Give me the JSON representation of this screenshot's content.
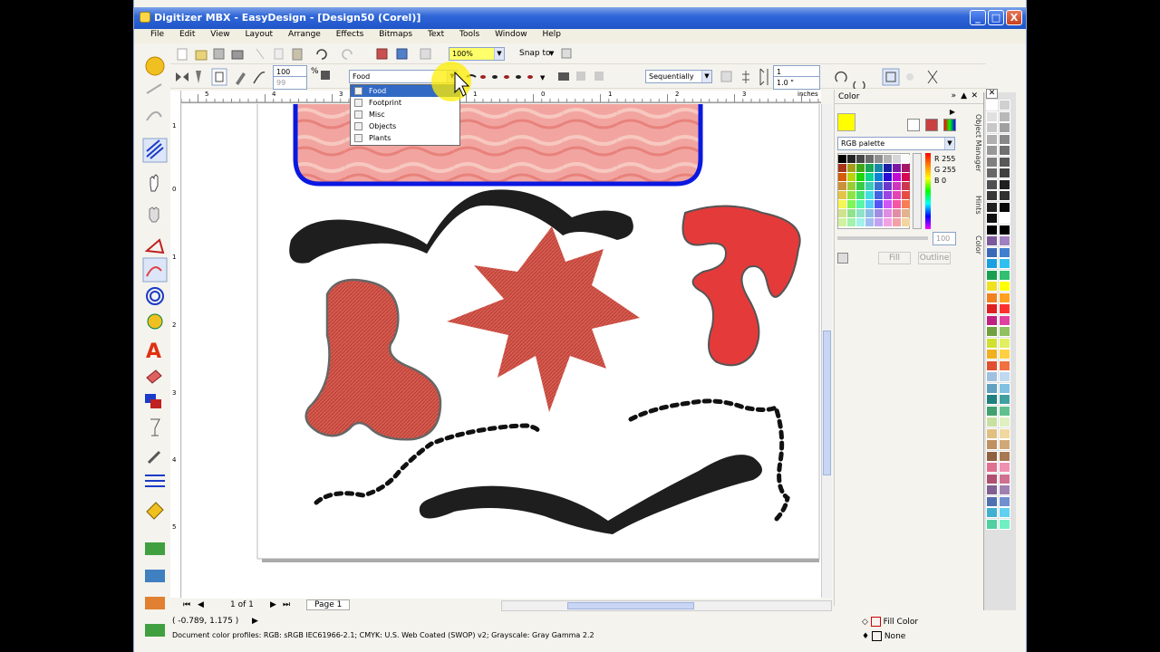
{
  "window": {
    "title": "Digitizer MBX - EasyDesign - [Design50 (Corel)]",
    "controls": [
      "_",
      "□",
      "X"
    ]
  },
  "menu": [
    "File",
    "Edit",
    "View",
    "Layout",
    "Arrange",
    "Effects",
    "Bitmaps",
    "Text",
    "Tools",
    "Window",
    "Help"
  ],
  "toolbar1": {
    "zoom": "100%",
    "snap_label": "Snap to"
  },
  "toolbar2": {
    "size_top": "100",
    "size_bottom": "99",
    "percent": "%",
    "category_value": "Food",
    "order_value": "Sequentially",
    "step_top": "1",
    "step_bottom": "1.0 \""
  },
  "dropdown": {
    "items": [
      "Food",
      "Footprint",
      "Misc",
      "Objects",
      "Plants"
    ],
    "selected": "Food"
  },
  "ruler": {
    "units": "inches",
    "top_ticks": [
      "5",
      "4",
      "3",
      "2",
      "1",
      "0",
      "1",
      "2",
      "3",
      "4"
    ],
    "left_ticks": [
      "1",
      "0",
      "1",
      "2",
      "3",
      "4",
      "5"
    ]
  },
  "page_nav": {
    "count": "1 of 1",
    "tab": "Page 1"
  },
  "status": {
    "coordinates": "( -0.789, 1.175 )",
    "profiles": "Document color profiles: RGB: sRGB IEC61966-2.1; CMYK: U.S. Web Coated (SWOP) v2; Grayscale: Gray Gamma 2.2",
    "fill_label": "Fill Color",
    "outline_label": "None"
  },
  "color_panel": {
    "title": "Color",
    "palette_select": "RGB palette",
    "r_label": "R",
    "r_value": "255",
    "g_label": "G",
    "g_value": "255",
    "b_label": "B",
    "b_value": "0",
    "tint_value": "100",
    "fill_button": "Fill",
    "outline_button": "Outline",
    "current_color": "#ffff00"
  },
  "side_tabs": [
    "Object Manager",
    "Hints",
    "Color"
  ],
  "colors": {
    "title_bar": "#2f66d8",
    "selection": "#316ac5",
    "shape_red": "#e53a3a",
    "stitch_red": "#d95a4e",
    "frame_blue": "#0b18e0",
    "shape_black": "#1e1e1e",
    "highlight_yellow": "#ffee00"
  }
}
